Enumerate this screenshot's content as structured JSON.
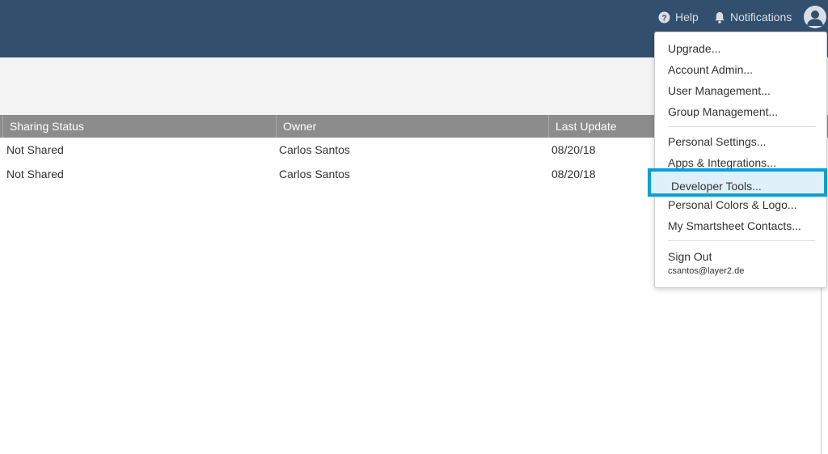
{
  "header": {
    "help_label": "Help",
    "notifications_label": "Notifications",
    "help_icon": "help-circle-icon",
    "notifications_icon": "bell-icon",
    "avatar_icon": "user-avatar-icon"
  },
  "table": {
    "columns": [
      "Sharing Status",
      "Owner",
      "Last Update"
    ],
    "rows": [
      {
        "sharing_status": "Not Shared",
        "owner": "Carlos Santos",
        "last_update": "08/20/18"
      },
      {
        "sharing_status": "Not Shared",
        "owner": "Carlos Santos",
        "last_update": "08/20/18"
      }
    ]
  },
  "account_menu": {
    "items": [
      "Upgrade...",
      "Account Admin...",
      "User Management...",
      "Group Management...",
      "Personal Settings...",
      "Apps & Integrations...",
      "Developer Tools...",
      "Personal Colors & Logo...",
      "My Smartsheet Contacts...",
      "Sign Out"
    ],
    "highlighted_item": "Developer Tools...",
    "email": "csantos@layer2.de"
  },
  "colors": {
    "topbar": "#32506e",
    "header_row": "#8c8c8c",
    "highlight_border": "#0a9fd6",
    "highlight_fill": "#dff0fa"
  }
}
